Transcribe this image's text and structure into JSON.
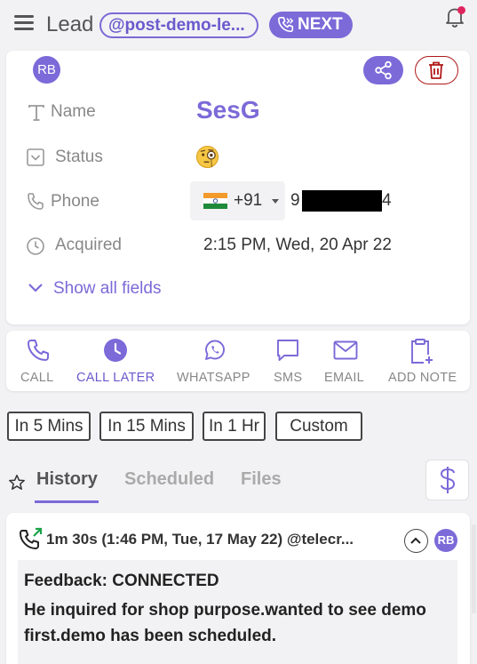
{
  "header": {
    "title": "Lead",
    "handle": "@post-demo-le...",
    "next_label": "NEXT"
  },
  "lead": {
    "avatar_initials": "RB",
    "fields": {
      "name_label": "Name",
      "name_value": "SesG",
      "status_label": "Status",
      "phone_label": "Phone",
      "phone_country_code": "+91",
      "phone_number_start": "9",
      "phone_number_end": "4",
      "acquired_label": "Acquired",
      "acquired_value": "2:15 PM, Wed, 20 Apr 22"
    },
    "show_all_label": "Show all fields"
  },
  "actions": [
    {
      "label": "CALL",
      "icon": "phone-icon"
    },
    {
      "label": "CALL LATER",
      "icon": "clock-icon"
    },
    {
      "label": "WHATSAPP",
      "icon": "whatsapp-icon"
    },
    {
      "label": "SMS",
      "icon": "message-icon"
    },
    {
      "label": "EMAIL",
      "icon": "mail-icon"
    },
    {
      "label": "ADD NOTE",
      "icon": "clipboard-plus-icon"
    }
  ],
  "schedule_options": [
    "In 5 Mins",
    "In 15 Mins",
    "In 1 Hr",
    "Custom"
  ],
  "tabs": [
    "History",
    "Scheduled",
    "Files"
  ],
  "history": {
    "call_summary": "1m 30s (1:46 PM, Tue, 17 May 22) @telecr...",
    "avatar_initials": "RB",
    "feedback_line": "Feedback: CONNECTED",
    "note_line_1": "He inquired for shop purpose.wanted to see demo",
    "note_line_2": "first.demo has been scheduled."
  },
  "colors": {
    "accent": "#7b6ad8",
    "delete": "#b01818",
    "notification": "#e0245e",
    "background": "#f2f2f4"
  }
}
